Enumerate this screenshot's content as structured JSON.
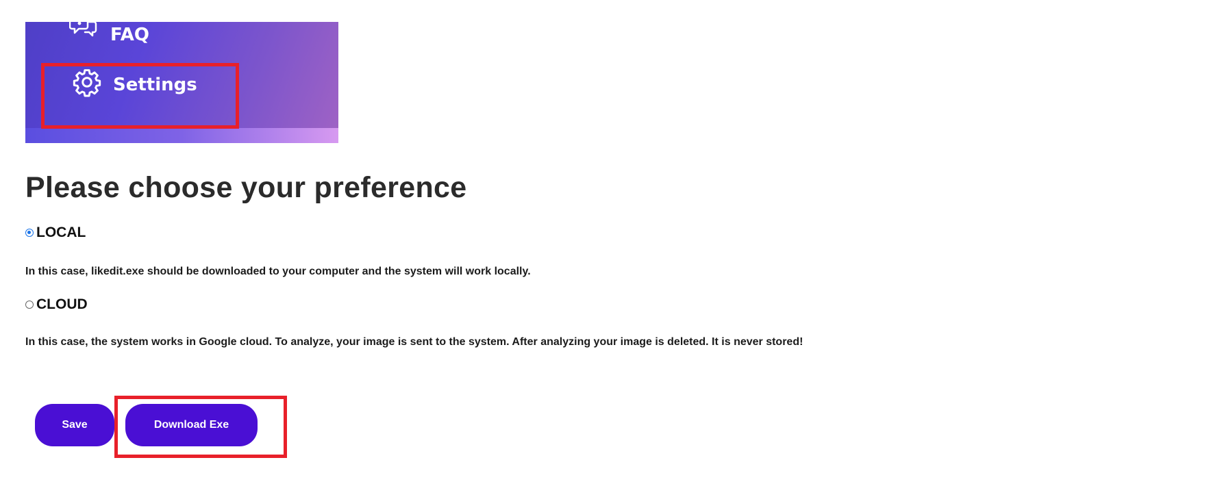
{
  "sidebar": {
    "items": [
      {
        "label": "FAQ",
        "icon": "faq-chat-icon"
      },
      {
        "label": "Settings",
        "icon": "gear-icon"
      }
    ],
    "highlight_color": "#e8202a"
  },
  "main": {
    "title": "Please choose your preference",
    "options": [
      {
        "label": "LOCAL",
        "checked": true,
        "description": "In this case, likedit.exe should be downloaded to your computer and the system will work locally."
      },
      {
        "label": "CLOUD",
        "checked": false,
        "description": "In this case, the system works in Google cloud. To analyze, your image is sent to the system. After analyzing your image is deleted. It is never stored!"
      }
    ],
    "buttons": {
      "save_label": "Save",
      "download_label": "Download Exe"
    },
    "button_color": "#4a0fd4"
  }
}
